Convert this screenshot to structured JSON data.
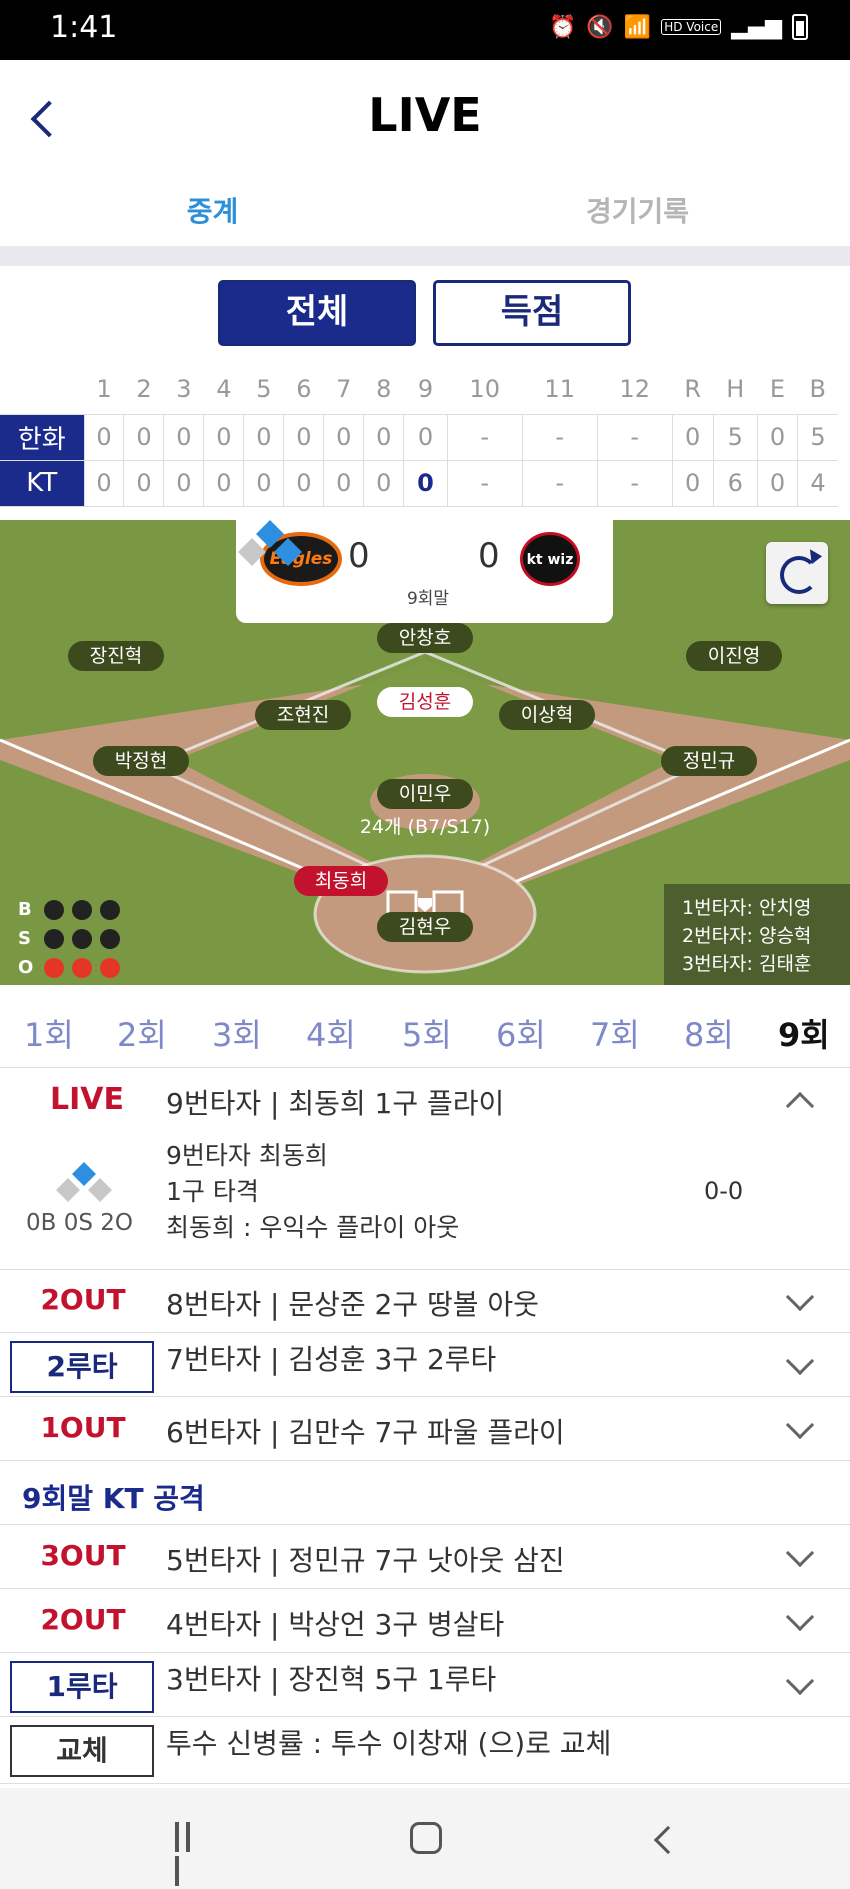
{
  "status_bar": {
    "time": "1:41",
    "hd_label": "HD\nVoice"
  },
  "header": {
    "title": "LIVE"
  },
  "tabs": [
    {
      "label": "중계"
    },
    {
      "label": "경기기록"
    }
  ],
  "filter": {
    "all": "전체",
    "score": "득점"
  },
  "scoreboard": {
    "columns": [
      "1",
      "2",
      "3",
      "4",
      "5",
      "6",
      "7",
      "8",
      "9",
      "10",
      "11",
      "12",
      "R",
      "H",
      "E",
      "B"
    ],
    "rows": [
      {
        "team": "한화",
        "cells": [
          "0",
          "0",
          "0",
          "0",
          "0",
          "0",
          "0",
          "0",
          "0",
          "-",
          "-",
          "-",
          "0",
          "5",
          "0",
          "5"
        ]
      },
      {
        "team": "KT",
        "cells": [
          "0",
          "0",
          "0",
          "0",
          "0",
          "0",
          "0",
          "0",
          "0",
          "-",
          "-",
          "-",
          "0",
          "6",
          "0",
          "4"
        ]
      }
    ]
  },
  "field": {
    "away_logo_text": "Eagles",
    "home_logo_text": "kt wiz",
    "away_score": "0",
    "home_score": "0",
    "inning": "9회말",
    "players": {
      "lf": "장진혁",
      "cf": "안창호",
      "rf": "이진영",
      "ss": "조현진",
      "runner": "김성훈",
      "2b": "이상혁",
      "3b": "박정현",
      "1b": "정민규",
      "pitcher": "이민우",
      "batter": "최동희",
      "catcher": "김현우"
    },
    "pitch_count": "24개 (B7/S17)",
    "bso": {
      "b": "B",
      "s": "S",
      "o": "O"
    },
    "next_batters": [
      "1번타자: 안치영",
      "2번타자: 양승혁",
      "3번타자: 김태훈"
    ]
  },
  "innings": [
    "1회",
    "2회",
    "3회",
    "4회",
    "5회",
    "6회",
    "7회",
    "8회",
    "9회"
  ],
  "live_event": {
    "label": "LIVE",
    "title": "9번타자 | 최동희 1구 플라이",
    "count": "0B 0S 2O",
    "lines": [
      "9번타자 최동희",
      "1구 타격",
      "최동희 : 우익수 플라이 아웃"
    ],
    "pitch_count": "0-0"
  },
  "events": [
    {
      "label": "2OUT",
      "text": "8번타자 | 문상준 2구 땅볼 아웃"
    },
    {
      "label": "2루타",
      "text": "7번타자 | 김성훈 3구 2루타"
    },
    {
      "label": "1OUT",
      "text": "6번타자 | 김만수 7구 파울 플라이"
    },
    {
      "section": "9회말 KT 공격"
    },
    {
      "label": "3OUT",
      "text": "5번타자 | 정민규 7구 낫아웃 삼진"
    },
    {
      "label": "2OUT",
      "text": "4번타자 | 박상언 3구 병살타"
    },
    {
      "label": "1루타",
      "text": "3번타자 | 장진혁 5구 1루타"
    },
    {
      "label": "교체",
      "text": "투수 신병률 : 투수 이창재 (으)로 교체"
    }
  ]
}
